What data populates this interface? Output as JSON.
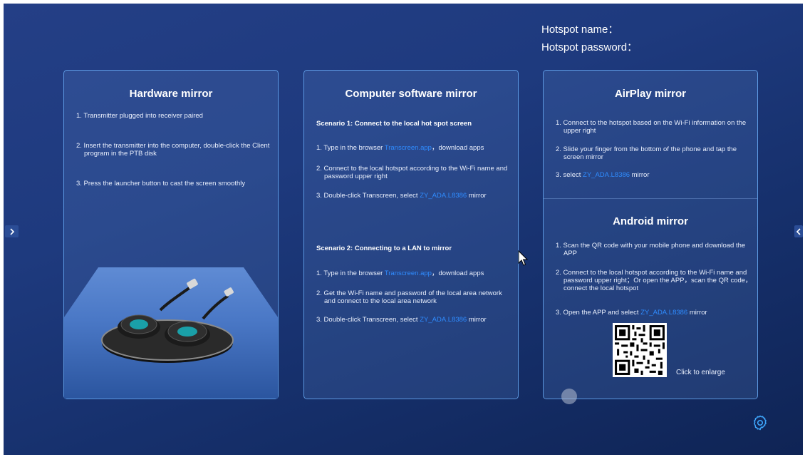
{
  "hotspot": {
    "name_label": "Hotspot name：",
    "password_label": "Hotspot password："
  },
  "hardware": {
    "title": "Hardware mirror",
    "steps": [
      "1. Transmitter plugged into receiver paired",
      "2. Insert the transmitter into the computer, double-click the Client program in the PTB disk",
      "3. Press the launcher button to cast the screen smoothly"
    ]
  },
  "computer": {
    "title": "Computer software mirror",
    "scenario1": {
      "heading": "Scenario 1: Connect to the local hot spot screen",
      "step1_prefix": "1. Type in the browser ",
      "step1_link": "Transcreen.app",
      "step1_suffix": "，download apps",
      "step2": "2. Connect to the local hotspot according to the Wi-Fi name and password upper right",
      "step3_prefix": "3. Double-click Transcreen, select ",
      "step3_link": "ZY_ADA.L8386",
      "step3_suffix": " mirror"
    },
    "scenario2": {
      "heading": "Scenario 2: Connecting to a LAN to mirror",
      "step1_prefix": "1. Type in the browser ",
      "step1_link": "Transcreen.app",
      "step1_suffix": "，download apps",
      "step2": "2. Get the Wi-Fi name and password of the local area network and connect to the local area network",
      "step3_prefix": "3. Double-click Transcreen, select ",
      "step3_link": "ZY_ADA.L8386",
      "step3_suffix": " mirror"
    }
  },
  "airplay": {
    "title": "AirPlay mirror",
    "step1": "1. Connect to the hotspot based on the Wi-Fi information on the upper right",
    "step2": "2. Slide your finger from the bottom of the phone and tap the screen mirror",
    "step3_prefix": "3. select ",
    "step3_link": "ZY_ADA.L8386",
    "step3_suffix": " mirror"
  },
  "android": {
    "title": "Android mirror",
    "step1": "1. Scan the QR code with your mobile phone and download the APP",
    "step2": "2. Connect to the local hotspot according to the Wi-Fi name and password upper right；Or open the APP，scan the QR code，connect the local hotspot",
    "step3_prefix": "3. Open the APP and select ",
    "step3_link": "ZY_ADA.L8386",
    "step3_suffix": " mirror",
    "qr_label": "Click to enlarge"
  },
  "icons": {
    "prev": "chevron-right-icon",
    "next": "chevron-left-icon",
    "settings": "gear-icon"
  },
  "colors": {
    "accent": "#2f8cff",
    "panel_border": "#6eb4ff",
    "background": "#1e3a7e"
  }
}
